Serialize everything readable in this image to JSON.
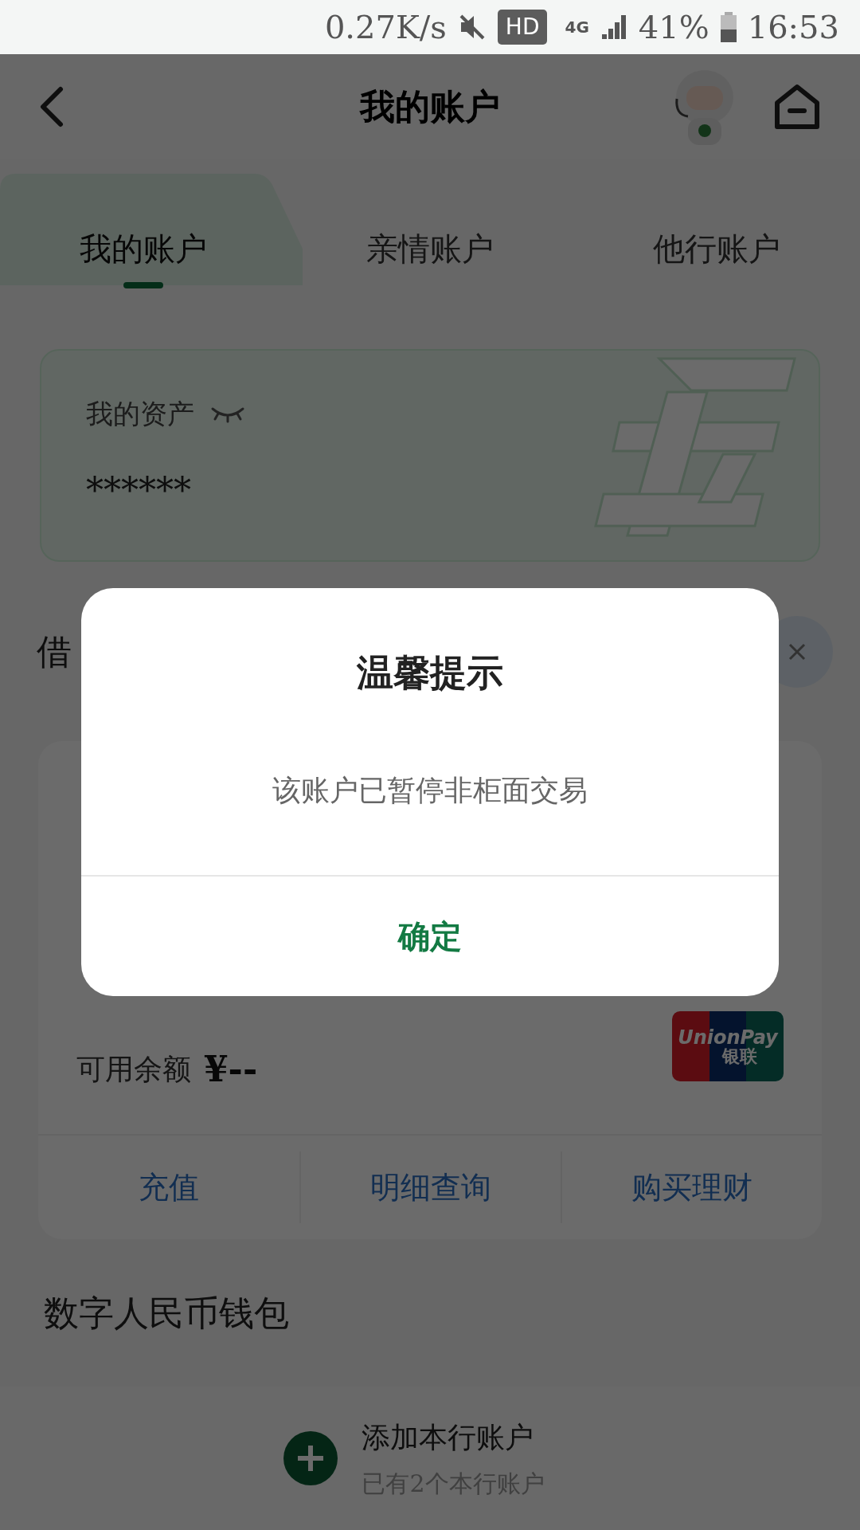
{
  "status_bar": {
    "network_speed": "0.27K/s",
    "hd": "HD",
    "network": "4G",
    "battery": "41%",
    "time": "16:53"
  },
  "nav": {
    "title": "我的账户"
  },
  "tabs": [
    {
      "label": "我的账户",
      "selected": true
    },
    {
      "label": "亲情账户",
      "selected": false
    },
    {
      "label": "他行账户",
      "selected": false
    }
  ],
  "assets": {
    "label": "我的资产",
    "value": "******"
  },
  "debit_section": {
    "heading": "借"
  },
  "card": {
    "balance_label": "可用余额",
    "balance": "¥--",
    "logo_text": "UnionPay",
    "logo_subtext": "银联",
    "actions": [
      "充值",
      "明细查询",
      "购买理财"
    ]
  },
  "wallet_section": {
    "heading": "数字人民币钱包"
  },
  "add_account": {
    "title": "添加本行账户",
    "subtitle": "已有2个本行账户"
  },
  "dialog": {
    "title": "温馨提示",
    "message": "该账户已暂停非柜面交易",
    "button": "确定"
  }
}
